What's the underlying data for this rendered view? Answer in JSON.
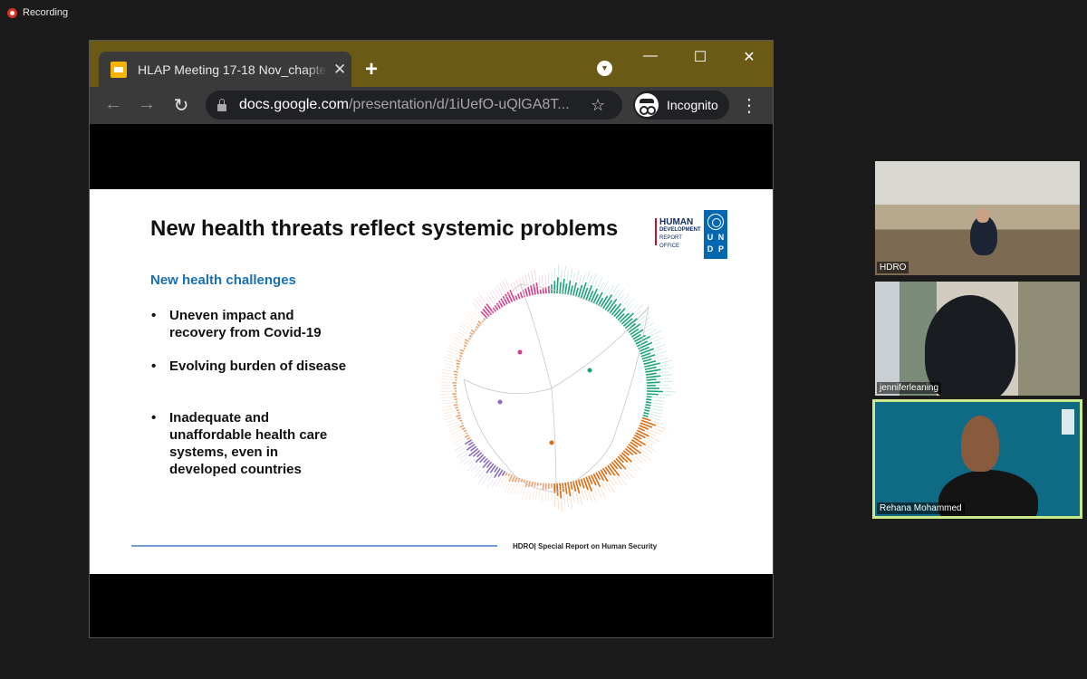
{
  "recording": {
    "label": "Recording"
  },
  "browser": {
    "tab_title": "HLAP Meeting 17-18 Nov_chapter",
    "tab_close_icon": "close-icon",
    "new_tab_icon": "plus-icon",
    "window_controls": {
      "minimize": "—",
      "maximize": "☐",
      "close": "✕"
    },
    "url_host": "docs.google.com",
    "url_path": "/presentation/d/1iUefO-uQlGA8T...",
    "profile_label": "Incognito",
    "icons": [
      "back-arrow-icon",
      "forward-arrow-icon",
      "reload-icon",
      "lock-icon",
      "star-icon",
      "incognito-icon",
      "kebab-menu-icon"
    ]
  },
  "slide": {
    "title": "New health threats reflect systemic problems",
    "logo_hdro": {
      "line1": "HUMAN",
      "line2": "DEVELOPMENT",
      "line3": "REPORT OFFICE"
    },
    "logo_undp": [
      "U",
      "N",
      "D",
      "P"
    ],
    "subheading": "New health challenges",
    "bullets": [
      "Uneven impact and recovery from Covid-19",
      "Evolving burden of disease",
      "Inadequate and unaffordable health care systems, even in developed countries"
    ],
    "footer": "HDRO|   Special Report on Human Security",
    "dendrogram_colors": {
      "green": "#1aa37a",
      "orange": "#e06a10",
      "purple": "#8a6bbf",
      "magenta": "#d63a8a",
      "peach": "#f0a070"
    }
  },
  "participants": [
    {
      "name": "HDRO"
    },
    {
      "name": "jenniferleaning"
    },
    {
      "name": "Rehana Mohammed",
      "active_speaker": true
    }
  ]
}
